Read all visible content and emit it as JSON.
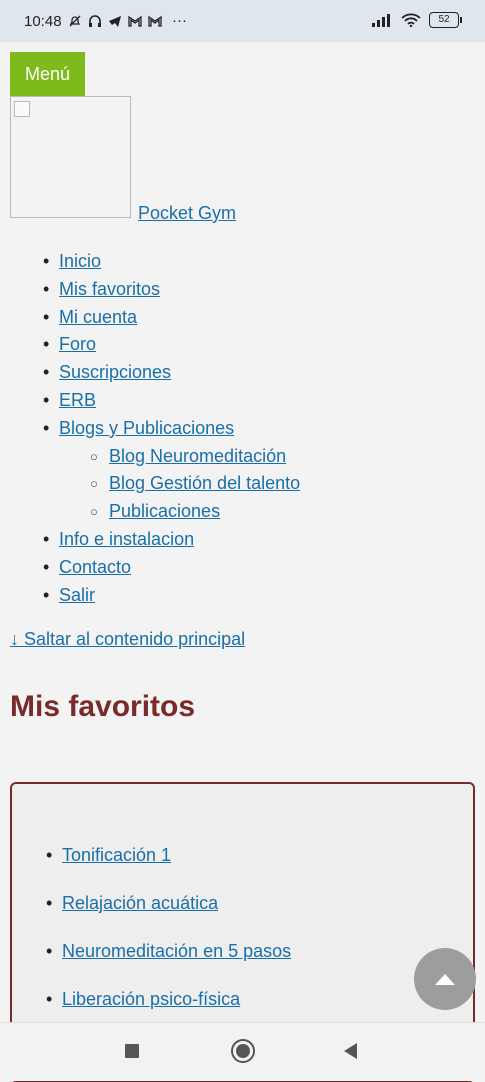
{
  "status_bar": {
    "time": "10:48",
    "more": "···",
    "battery": "52",
    "left_icons": [
      "mute-bell-icon",
      "headphones-icon",
      "telegram-icon",
      "gmail-icon",
      "gmail-icon"
    ],
    "right_icons": [
      "signal-icon",
      "wifi-icon",
      "battery-icon"
    ]
  },
  "menu_button": "Menú",
  "site": {
    "name": "Pocket Gym"
  },
  "nav": {
    "items": [
      "Inicio",
      "Mis favoritos",
      "Mi cuenta",
      "Foro",
      "Suscripciones",
      "ERB",
      "Blogs y Publicaciones",
      "Info e instalacion",
      "Contacto",
      "Salir"
    ],
    "sub_items": [
      "Blog Neuromeditación",
      "Blog Gestión del talento",
      "Publicaciones"
    ]
  },
  "skip_link": "↓ Saltar al contenido principal",
  "page_title": "Mis favoritos",
  "favorites": [
    "Tonificación 1",
    "Relajación acuática",
    "Neuromeditación en 5 pasos",
    "Liberación psico-física"
  ],
  "colors": {
    "menu_bg": "#7fba1b",
    "link": "#1a6fa8",
    "title": "#7a2a2a",
    "panel_border": "#7a2a2a",
    "fab": "#9d9d9d"
  }
}
